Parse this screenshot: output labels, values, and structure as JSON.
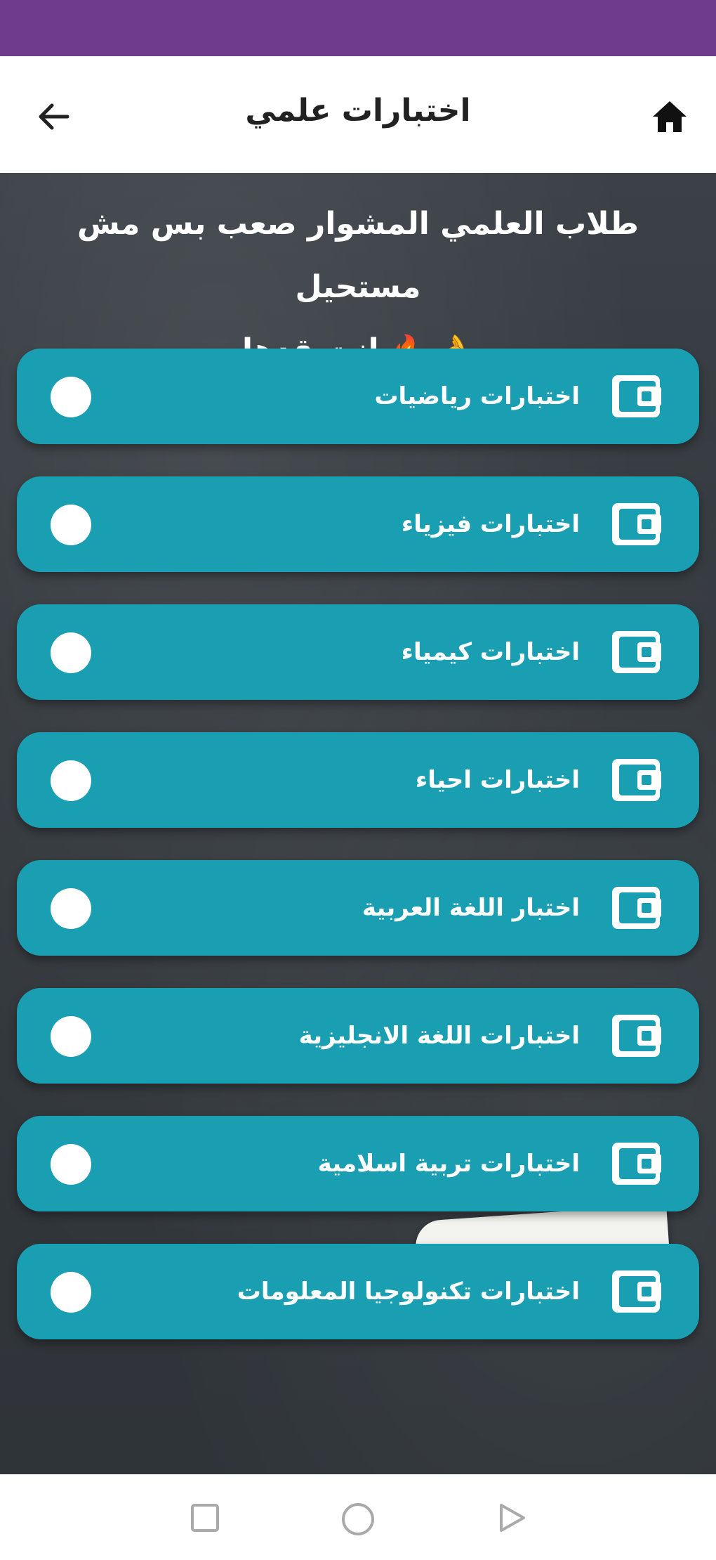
{
  "status_bar": {
    "left_text": "",
    "right_text": ""
  },
  "app_bar": {
    "title": "اختبارات علمي"
  },
  "headline": {
    "line1": "طلاب العلمي المشوار صعب بس مش مستحيل",
    "line2": "انت قدها",
    "emoji": [
      "🔥",
      "👌"
    ]
  },
  "items": [
    {
      "label": "اختبارات رياضيات"
    },
    {
      "label": "اختبارات فيزياء"
    },
    {
      "label": "اختبارات كيمياء"
    },
    {
      "label": "اختبارات احياء"
    },
    {
      "label": "اختبار اللغة العربية"
    },
    {
      "label": "اختبارات اللغة الانجليزية"
    },
    {
      "label": "اختبارات تربية اسلامية"
    },
    {
      "label": "اختبارات تكنولوجيا المعلومات"
    }
  ],
  "colors": {
    "status_bar": "#6f3c8c",
    "item_bg": "#1a9fb2",
    "board": "#33383d"
  },
  "icons": {
    "back": "arrow-left-icon",
    "home": "home-icon",
    "item": "wallet-icon",
    "nav": [
      "square-icon",
      "circle-icon",
      "triangle-icon"
    ]
  }
}
